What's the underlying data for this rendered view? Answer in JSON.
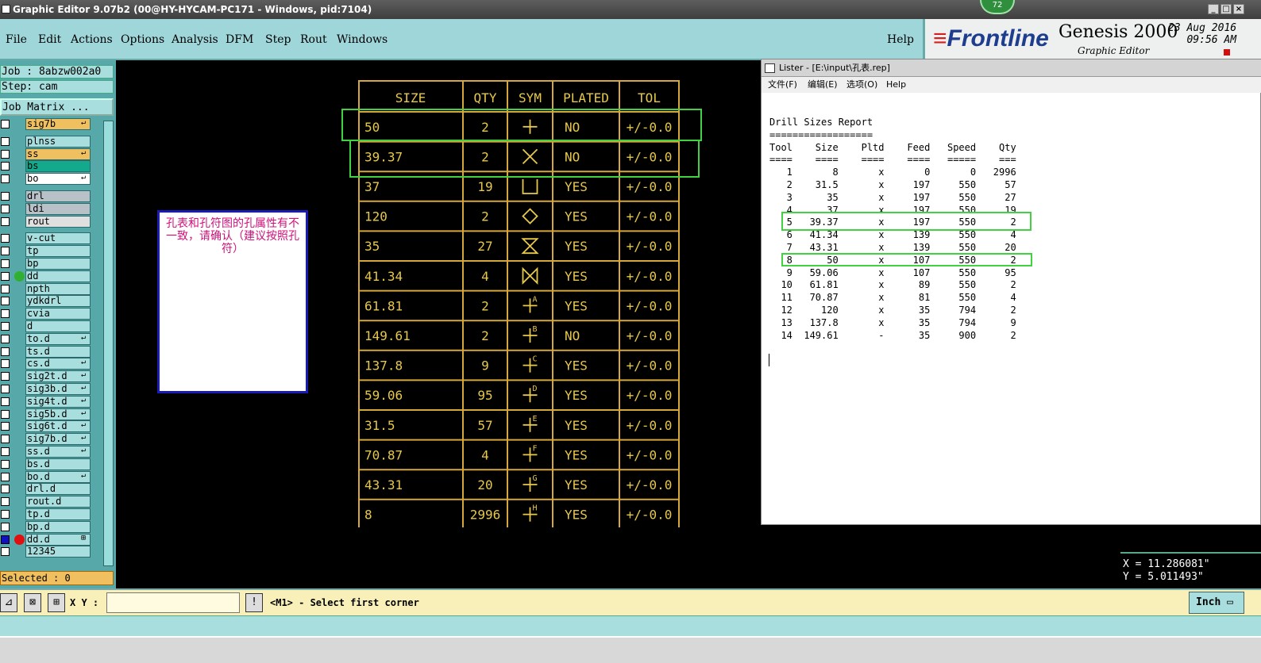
{
  "window": {
    "title": "Graphic Editor 9.07b2 (00@HY-HYCAM-PC171 - Windows, pid:7104)",
    "badge": "72"
  },
  "menu": [
    "File",
    "Edit",
    "Actions",
    "Options",
    "Analysis",
    "DFM",
    "Step",
    "Rout",
    "Windows"
  ],
  "help_label": "Help",
  "brand": {
    "logo": "Frontline",
    "product": "Genesis 2000",
    "subtitle": "Graphic Editor",
    "date": "23 Aug 2016",
    "time": "09:56 AM"
  },
  "left": {
    "job": "Job : 8abzw002a0",
    "step": "Step: cam",
    "matrix_button": "Job Matrix ...",
    "layers": [
      {
        "name": "sig7b",
        "color": "#f0c060",
        "mark": "↵"
      },
      {
        "name": "plnss",
        "color": "#a8dede",
        "mark": ""
      },
      {
        "name": "ss",
        "color": "#f0c060",
        "mark": "↵"
      },
      {
        "name": "bs",
        "color": "#14a88c",
        "mark": ""
      },
      {
        "name": "bo",
        "color": "#ffffff",
        "mark": "↵"
      },
      {
        "name": "drl",
        "color": "#b8c0c8",
        "mark": ""
      },
      {
        "name": "ldi",
        "color": "#b8c0c8",
        "mark": ""
      },
      {
        "name": "rout",
        "color": "#e0e0e0",
        "mark": ""
      },
      {
        "name": "v-cut",
        "color": "#a8dede",
        "mark": ""
      },
      {
        "name": "tp",
        "color": "#a8dede",
        "mark": ""
      },
      {
        "name": "bp",
        "color": "#a8dede",
        "mark": ""
      },
      {
        "name": "dd",
        "color": "#a8dede",
        "mark": "",
        "dot": "#30b030"
      },
      {
        "name": "npth",
        "color": "#a8dede",
        "mark": ""
      },
      {
        "name": "ydkdrl",
        "color": "#a8dede",
        "mark": ""
      },
      {
        "name": "cvia",
        "color": "#a8dede",
        "mark": ""
      },
      {
        "name": "d",
        "color": "#a8dede",
        "mark": ""
      },
      {
        "name": "to.d",
        "color": "#a8dede",
        "mark": "↵"
      },
      {
        "name": "ts.d",
        "color": "#a8dede",
        "mark": ""
      },
      {
        "name": "cs.d",
        "color": "#a8dede",
        "mark": "↵"
      },
      {
        "name": "sig2t.d",
        "color": "#a8dede",
        "mark": "↵"
      },
      {
        "name": "sig3b.d",
        "color": "#a8dede",
        "mark": "↵"
      },
      {
        "name": "sig4t.d",
        "color": "#a8dede",
        "mark": "↵"
      },
      {
        "name": "sig5b.d",
        "color": "#a8dede",
        "mark": "↵"
      },
      {
        "name": "sig6t.d",
        "color": "#a8dede",
        "mark": "↵"
      },
      {
        "name": "sig7b.d",
        "color": "#a8dede",
        "mark": "↵"
      },
      {
        "name": "ss.d",
        "color": "#a8dede",
        "mark": "↵"
      },
      {
        "name": "bs.d",
        "color": "#a8dede",
        "mark": ""
      },
      {
        "name": "bo.d",
        "color": "#a8dede",
        "mark": "↵"
      },
      {
        "name": "drl.d",
        "color": "#a8dede",
        "mark": ""
      },
      {
        "name": "rout.d",
        "color": "#a8dede",
        "mark": ""
      },
      {
        "name": "tp.d",
        "color": "#a8dede",
        "mark": ""
      },
      {
        "name": "bp.d",
        "color": "#a8dede",
        "mark": ""
      },
      {
        "name": "dd.d",
        "color": "#a8dede",
        "mark": "⊞",
        "dot": "#e01010",
        "active": true
      },
      {
        "name": "12345",
        "color": "#a8dede",
        "mark": ""
      }
    ],
    "selected": "Selected : 0"
  },
  "note": "孔表和孔符图的孔属性有不一致，请确认（建议按照孔符）",
  "drill_table": {
    "headers": [
      "SIZE",
      "QTY",
      "SYM",
      "PLATED",
      "TOL"
    ],
    "rows": [
      {
        "size": "50",
        "qty": "2",
        "sym": "plus",
        "plated": "NO",
        "tol": "+/-0.0"
      },
      {
        "size": "39.37",
        "qty": "2",
        "sym": "x",
        "plated": "NO",
        "tol": "+/-0.0"
      },
      {
        "size": "37",
        "qty": "19",
        "sym": "cup",
        "plated": "YES",
        "tol": "+/-0.0"
      },
      {
        "size": "120",
        "qty": "2",
        "sym": "diamond",
        "plated": "YES",
        "tol": "+/-0.0"
      },
      {
        "size": "35",
        "qty": "27",
        "sym": "hourglass",
        "plated": "YES",
        "tol": "+/-0.0"
      },
      {
        "size": "41.34",
        "qty": "4",
        "sym": "bowtie",
        "plated": "YES",
        "tol": "+/-0.0"
      },
      {
        "size": "61.81",
        "qty": "2",
        "sym": "plus-A",
        "plated": "YES",
        "tol": "+/-0.0"
      },
      {
        "size": "149.61",
        "qty": "2",
        "sym": "plus-B",
        "plated": "NO",
        "tol": "+/-0.0"
      },
      {
        "size": "137.8",
        "qty": "9",
        "sym": "plus-C",
        "plated": "YES",
        "tol": "+/-0.0"
      },
      {
        "size": "59.06",
        "qty": "95",
        "sym": "plus-D",
        "plated": "YES",
        "tol": "+/-0.0"
      },
      {
        "size": "31.5",
        "qty": "57",
        "sym": "plus-E",
        "plated": "YES",
        "tol": "+/-0.0"
      },
      {
        "size": "70.87",
        "qty": "4",
        "sym": "plus-F",
        "plated": "YES",
        "tol": "+/-0.0"
      },
      {
        "size": "43.31",
        "qty": "20",
        "sym": "plus-G",
        "plated": "YES",
        "tol": "+/-0.0"
      },
      {
        "size": "8",
        "qty": "2996",
        "sym": "plus-H",
        "plated": "YES",
        "tol": "+/-0.0"
      }
    ]
  },
  "lister": {
    "title": "Lister - [E:\\input\\孔表.rep]",
    "menu": [
      "文件(F)",
      "编辑(E)",
      "选项(O)",
      "Help"
    ],
    "report_title": "Drill Sizes Report",
    "underline": "==================",
    "headers": [
      "Tool",
      "Size",
      "Pltd",
      "Feed",
      "Speed",
      "Qty"
    ],
    "header_rule": [
      "====",
      "====",
      "====",
      "====",
      "=====",
      "==="
    ],
    "rows": [
      [
        "1",
        "8",
        "x",
        "0",
        "0",
        "2996"
      ],
      [
        "2",
        "31.5",
        "x",
        "197",
        "550",
        "57"
      ],
      [
        "3",
        "35",
        "x",
        "197",
        "550",
        "27"
      ],
      [
        "4",
        "37",
        "x",
        "197",
        "550",
        "19"
      ],
      [
        "5",
        "39.37",
        "x",
        "197",
        "550",
        "2"
      ],
      [
        "6",
        "41.34",
        "x",
        "139",
        "550",
        "4"
      ],
      [
        "7",
        "43.31",
        "x",
        "139",
        "550",
        "20"
      ],
      [
        "8",
        "50",
        "x",
        "107",
        "550",
        "2"
      ],
      [
        "9",
        "59.06",
        "x",
        "107",
        "550",
        "95"
      ],
      [
        "10",
        "61.81",
        "x",
        "89",
        "550",
        "2"
      ],
      [
        "11",
        "70.87",
        "x",
        "81",
        "550",
        "4"
      ],
      [
        "12",
        "120",
        "x",
        "35",
        "794",
        "2"
      ],
      [
        "13",
        "137.8",
        "x",
        "35",
        "794",
        "9"
      ],
      [
        "14",
        "149.61",
        "-",
        "35",
        "900",
        "2"
      ]
    ]
  },
  "coords": {
    "x": "X = 11.286081\"",
    "y": "Y = 5.011493\""
  },
  "command": {
    "xy_label": "X Y :",
    "xy_value": "",
    "prompt": "<M1> - Select first corner",
    "units": "Inch"
  },
  "colors": {
    "table_line": "#d6a73a",
    "table_text": "#e8c84a",
    "highlight": "#41d141"
  }
}
